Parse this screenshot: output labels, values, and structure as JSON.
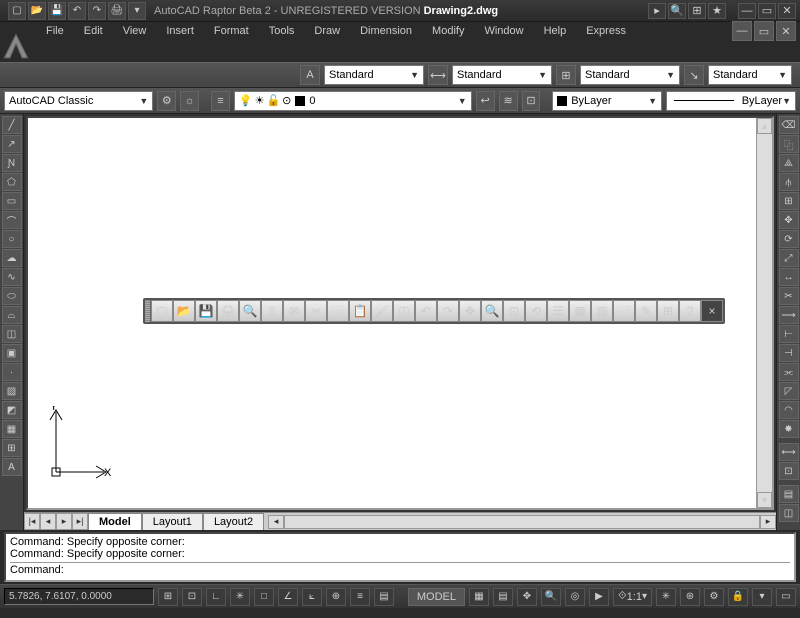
{
  "title_prefix": "AutoCAD Raptor Beta 2 - UNREGISTERED VERSION",
  "title_doc": "Drawing2.dwg",
  "menu": [
    "File",
    "Edit",
    "View",
    "Insert",
    "Format",
    "Tools",
    "Draw",
    "Dimension",
    "Modify",
    "Window",
    "Help",
    "Express"
  ],
  "styles": {
    "textstyle": "Standard",
    "dimstyle": "Standard",
    "tablestyle": "Standard",
    "mlstyle": "Standard"
  },
  "workspace": "AutoCAD Classic",
  "layer": {
    "current": "0",
    "color": "black"
  },
  "properties": {
    "color": "ByLayer",
    "linetype": "ByLayer"
  },
  "tabs": {
    "active": "Model",
    "items": [
      "Model",
      "Layout1",
      "Layout2"
    ]
  },
  "command": {
    "history": [
      "Command: Specify opposite corner:",
      "Command: Specify opposite corner:"
    ],
    "prompt": "Command:"
  },
  "status": {
    "coord": "5.7826, 7.6107, 0.0000",
    "space": "MODEL",
    "scale": "1:1"
  },
  "ucs": {
    "x": "X",
    "y": "Y"
  },
  "left_tools": [
    "line",
    "construction-line",
    "polyline",
    "polygon",
    "rectangle",
    "arc",
    "circle",
    "revcloud",
    "spline",
    "ellipse",
    "ellipse-arc",
    "block",
    "point",
    "hatch",
    "gradient",
    "region",
    "table",
    "text"
  ],
  "right_tools": [
    "erase",
    "copy",
    "mirror",
    "offset",
    "array",
    "move",
    "rotate",
    "scale",
    "stretch",
    "trim",
    "extend",
    "break",
    "break2",
    "join",
    "chamfer",
    "fillet",
    "explode",
    "sep",
    "dist",
    "area",
    "sep",
    "draworder",
    "block-editor"
  ],
  "floating_tools": [
    "new",
    "open",
    "save",
    "plot",
    "plot-preview",
    "publish",
    "cut",
    "copy",
    "paste",
    "match",
    "undo",
    "redo",
    "pan",
    "zoom-rt",
    "zoom-win",
    "zoom-prev",
    "properties",
    "dcenter",
    "tool-palettes",
    "sheetset",
    "markup",
    "qcalc",
    "help"
  ],
  "status_toggles": [
    "snap",
    "grid",
    "ortho",
    "polar",
    "osnap",
    "otrack",
    "ducs",
    "dyn",
    "lwt",
    "model"
  ],
  "status_right": [
    "model-space",
    "quick-view-layouts",
    "quick-view-drawings",
    "pan",
    "zoom",
    "steering-wheel",
    "showmotion",
    "annotation-scale",
    "annotation-vis",
    "annotation-auto",
    "workspace-switch",
    "lock-ui",
    "clean-screen"
  ]
}
